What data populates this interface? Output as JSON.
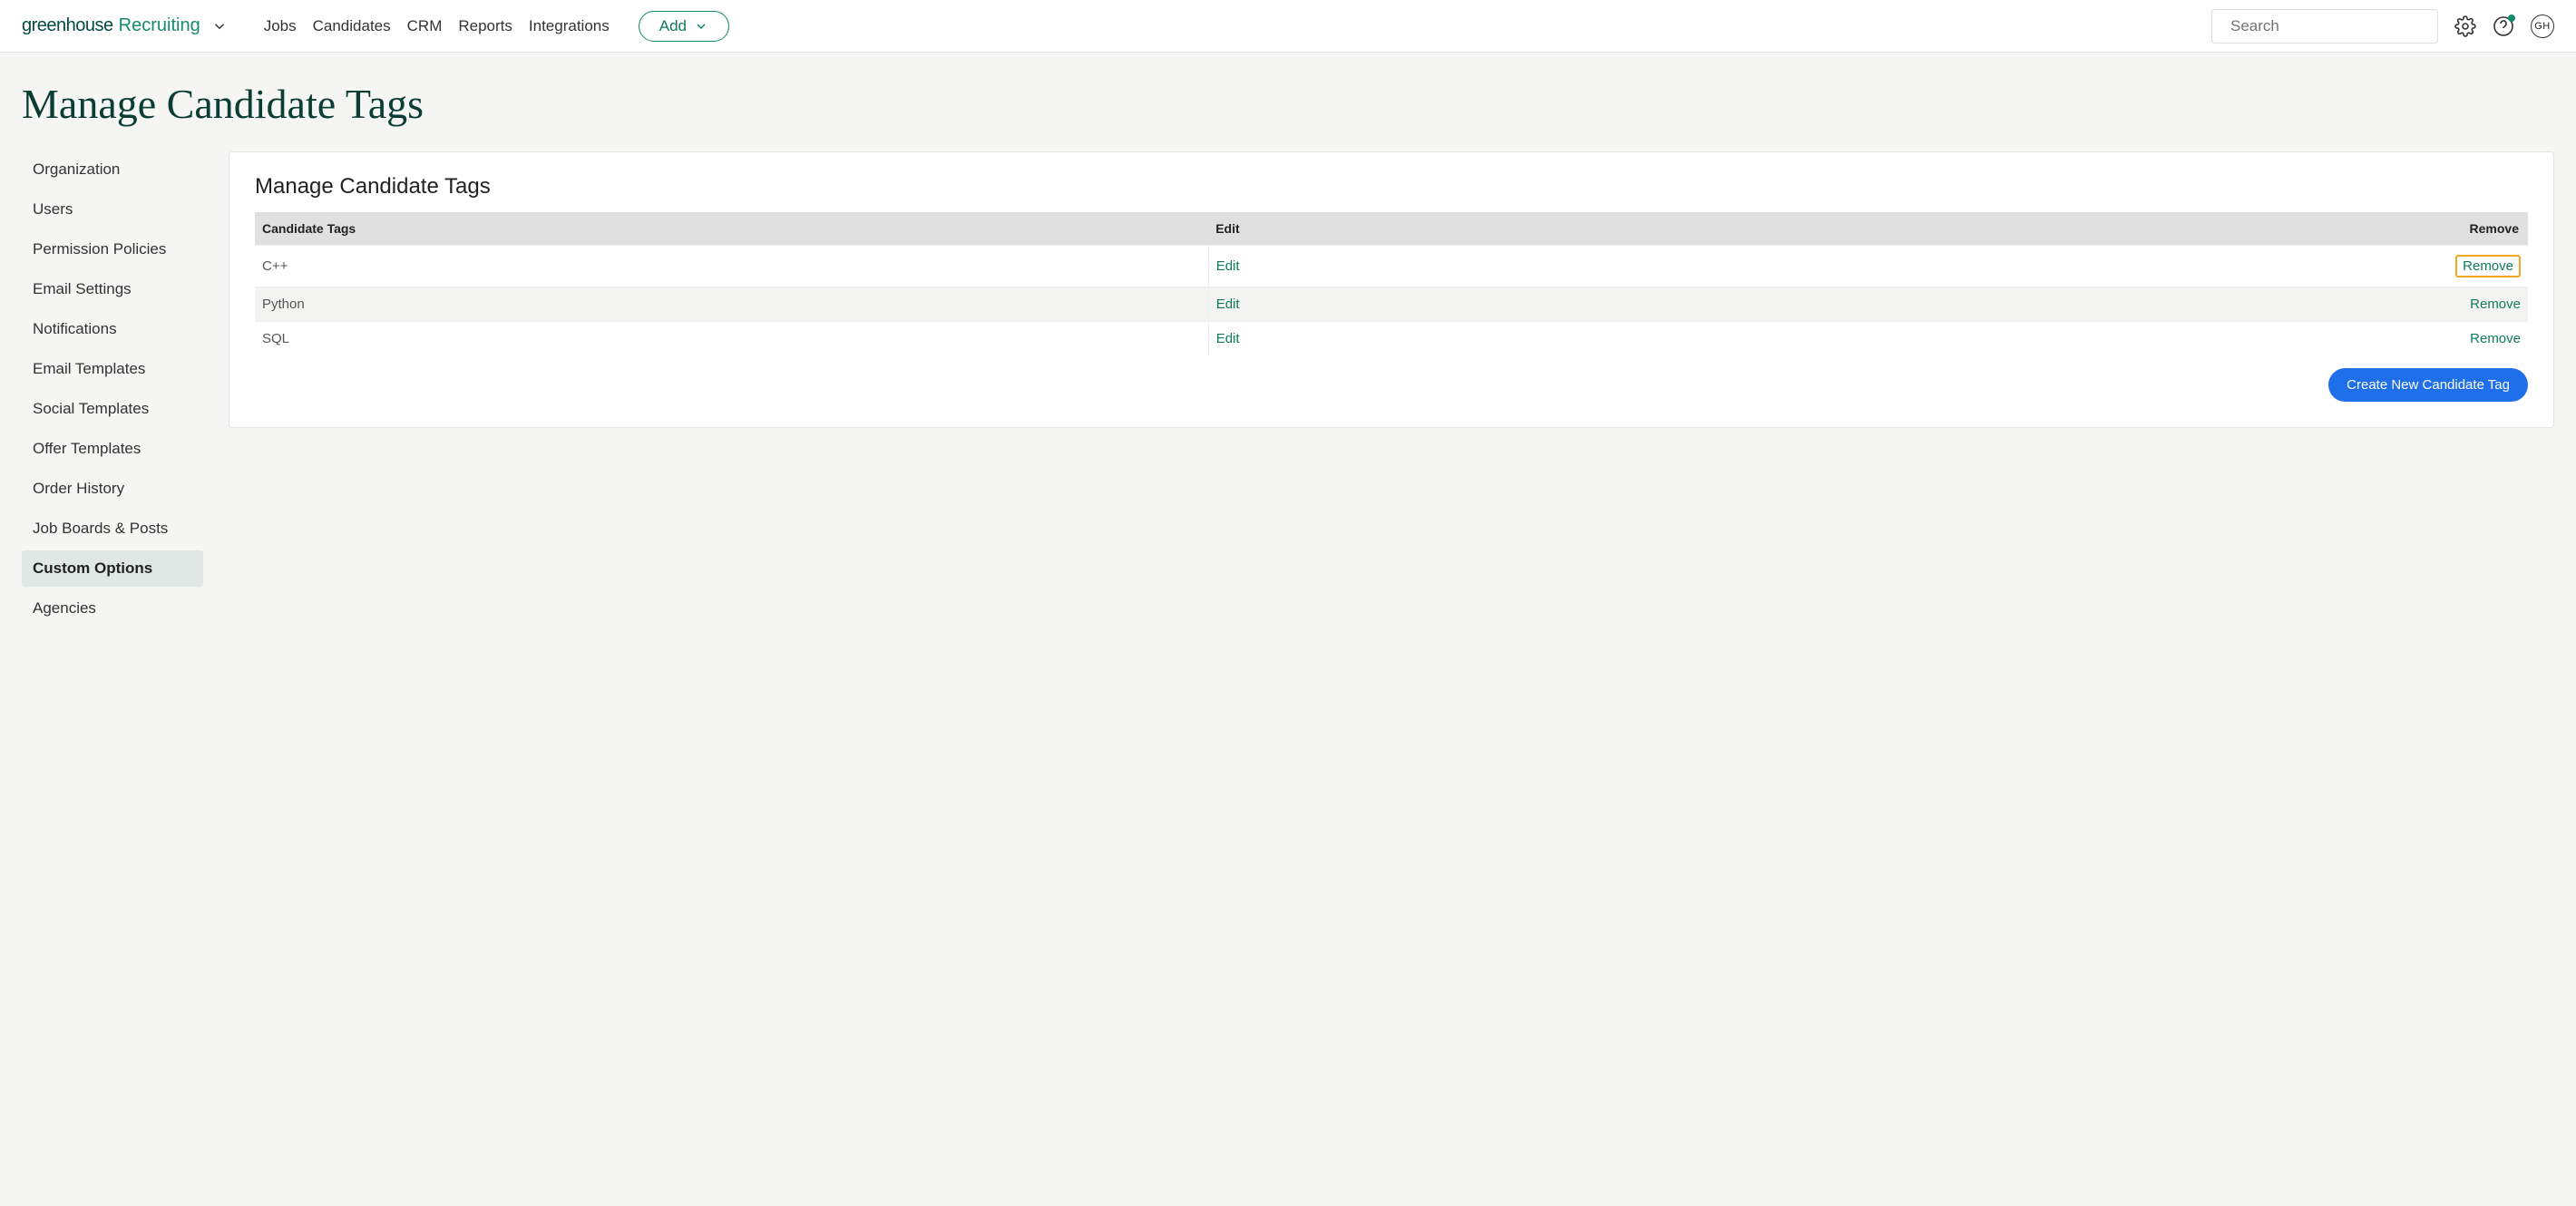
{
  "brand": {
    "word": "greenhouse",
    "product": "Recruiting"
  },
  "nav": {
    "jobs": "Jobs",
    "candidates": "Candidates",
    "crm": "CRM",
    "reports": "Reports",
    "integrations": "Integrations",
    "add": "Add"
  },
  "search": {
    "placeholder": "Search"
  },
  "avatar_initials": "GH",
  "page_title": "Manage Candidate Tags",
  "sidebar": {
    "items": [
      {
        "label": "Organization",
        "active": false
      },
      {
        "label": "Users",
        "active": false
      },
      {
        "label": "Permission Policies",
        "active": false
      },
      {
        "label": "Email Settings",
        "active": false
      },
      {
        "label": "Notifications",
        "active": false
      },
      {
        "label": "Email Templates",
        "active": false
      },
      {
        "label": "Social Templates",
        "active": false
      },
      {
        "label": "Offer Templates",
        "active": false
      },
      {
        "label": "Order History",
        "active": false
      },
      {
        "label": "Job Boards & Posts",
        "active": false
      },
      {
        "label": "Custom Options",
        "active": true
      },
      {
        "label": "Agencies",
        "active": false
      }
    ]
  },
  "panel": {
    "title": "Manage Candidate Tags",
    "columns": {
      "name": "Candidate Tags",
      "edit": "Edit",
      "remove": "Remove"
    },
    "edit_label": "Edit",
    "remove_label": "Remove",
    "rows": [
      {
        "name": "C++",
        "highlight_remove": true
      },
      {
        "name": "Python",
        "highlight_remove": false
      },
      {
        "name": "SQL",
        "highlight_remove": false
      }
    ],
    "create_btn": "Create New Candidate Tag"
  },
  "colors": {
    "brand_green": "#0f7a5c",
    "title_green": "#0a3d33",
    "highlight_orange": "#f5a623",
    "primary_blue": "#1f6feb"
  }
}
